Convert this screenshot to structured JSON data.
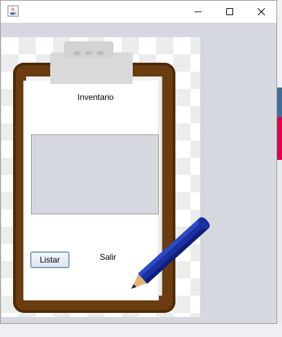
{
  "window": {
    "app_icon": "java-coffee-icon",
    "controls": {
      "minimize": "minimize-icon",
      "maximize": "maximize-icon",
      "close": "close-icon"
    }
  },
  "form": {
    "title": "Inventario",
    "list_button_label": "Listar",
    "exit_label": "Salir"
  },
  "decor": {
    "clipboard": "clipboard-image",
    "pencil": "pencil-image"
  },
  "colors": {
    "panel_bg": "#d6d8e0",
    "board_brown": "#6b3c10",
    "pencil_blue": "#1a2fa0"
  }
}
